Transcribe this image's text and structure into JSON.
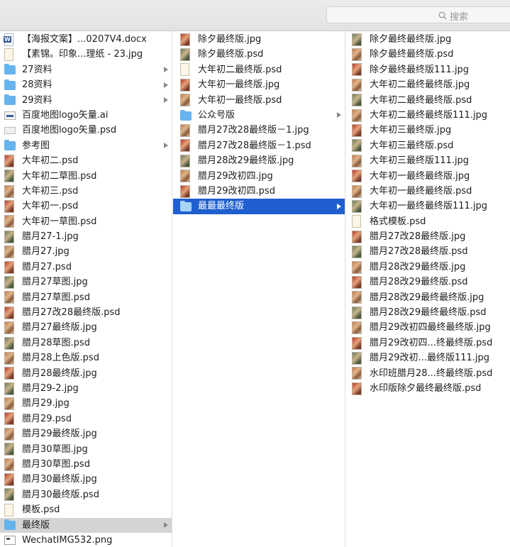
{
  "search": {
    "placeholder": "搜索"
  },
  "columns": [
    {
      "items": [
        {
          "label": "【海报文案】...0207V4.docx",
          "icon": "word-doc-icon"
        },
        {
          "label": "【素锦。印象...理纸 - 23.jpg",
          "icon": "blank-image-icon"
        },
        {
          "label": "27资料",
          "icon": "folder-icon",
          "arrow": true
        },
        {
          "label": "28资料",
          "icon": "folder-icon",
          "arrow": true
        },
        {
          "label": "29资料",
          "icon": "folder-icon",
          "arrow": true
        },
        {
          "label": "百度地图logo矢量.ai",
          "icon": "ai-file-icon"
        },
        {
          "label": "百度地图logo矢量.psd",
          "icon": "psd-file-icon"
        },
        {
          "label": "参考图",
          "icon": "folder-icon",
          "arrow": true
        },
        {
          "label": "大年初二.psd",
          "icon": "image-thumbnail-icon"
        },
        {
          "label": "大年初二草图.psd",
          "icon": "image-thumbnail-icon"
        },
        {
          "label": "大年初三.psd",
          "icon": "image-thumbnail-icon"
        },
        {
          "label": "大年初一.psd",
          "icon": "image-thumbnail-icon"
        },
        {
          "label": "大年初一草图.psd",
          "icon": "image-thumbnail-icon"
        },
        {
          "label": "腊月27-1.jpg",
          "icon": "image-thumbnail-icon"
        },
        {
          "label": "腊月27.jpg",
          "icon": "image-thumbnail-icon"
        },
        {
          "label": "腊月27.psd",
          "icon": "image-thumbnail-icon"
        },
        {
          "label": "腊月27草图.jpg",
          "icon": "image-thumbnail-icon"
        },
        {
          "label": "腊月27草图.psd",
          "icon": "image-thumbnail-icon"
        },
        {
          "label": "腊月27改28最终版.psd",
          "icon": "image-thumbnail-icon"
        },
        {
          "label": "腊月27最终版.jpg",
          "icon": "image-thumbnail-icon"
        },
        {
          "label": "腊月28草图.psd",
          "icon": "image-thumbnail-icon"
        },
        {
          "label": "腊月28上色版.psd",
          "icon": "image-thumbnail-icon"
        },
        {
          "label": "腊月28最终版.jpg",
          "icon": "image-thumbnail-icon"
        },
        {
          "label": "腊月29-2.jpg",
          "icon": "image-thumbnail-icon"
        },
        {
          "label": "腊月29.jpg",
          "icon": "image-thumbnail-icon"
        },
        {
          "label": "腊月29.psd",
          "icon": "image-thumbnail-icon"
        },
        {
          "label": "腊月29最终版.jpg",
          "icon": "image-thumbnail-icon"
        },
        {
          "label": "腊月30草图.jpg",
          "icon": "image-thumbnail-icon"
        },
        {
          "label": "腊月30草图.psd",
          "icon": "image-thumbnail-icon"
        },
        {
          "label": "腊月30最终版.jpg",
          "icon": "image-thumbnail-icon"
        },
        {
          "label": "腊月30最终版.psd",
          "icon": "image-thumbnail-icon"
        },
        {
          "label": "模板.psd",
          "icon": "blank-image-icon"
        },
        {
          "label": "最终版",
          "icon": "folder-icon",
          "arrow": true,
          "state": "inactive-selected"
        },
        {
          "label": "WechatIMG532.png",
          "icon": "png-file-icon"
        }
      ]
    },
    {
      "items": [
        {
          "label": "除夕最终版.jpg",
          "icon": "image-thumbnail-icon"
        },
        {
          "label": "除夕最终版.psd",
          "icon": "image-thumbnail-icon"
        },
        {
          "label": "大年初二最终版.psd",
          "icon": "blank-image-icon"
        },
        {
          "label": "大年初一最终版.jpg",
          "icon": "image-thumbnail-icon"
        },
        {
          "label": "大年初一最终版.psd",
          "icon": "image-thumbnail-icon"
        },
        {
          "label": "公众号版",
          "icon": "folder-icon",
          "arrow": true
        },
        {
          "label": "腊月27改28最终版－1.jpg",
          "icon": "image-thumbnail-icon"
        },
        {
          "label": "腊月27改28最终版－1.psd",
          "icon": "image-thumbnail-icon"
        },
        {
          "label": "腊月28改29最终版.jpg",
          "icon": "image-thumbnail-icon"
        },
        {
          "label": "腊月29改初四.jpg",
          "icon": "image-thumbnail-icon"
        },
        {
          "label": "腊月29改初四.psd",
          "icon": "image-thumbnail-icon"
        },
        {
          "label": "最最最终版",
          "icon": "folder-icon",
          "arrow": true,
          "state": "selected"
        }
      ]
    },
    {
      "items": [
        {
          "label": "除夕最终最终版.jpg",
          "icon": "image-thumbnail-icon"
        },
        {
          "label": "除夕最终最终版.psd",
          "icon": "image-thumbnail-icon"
        },
        {
          "label": "除夕最终最终版111.jpg",
          "icon": "image-thumbnail-icon"
        },
        {
          "label": "大年初二最终最终版.jpg",
          "icon": "image-thumbnail-icon"
        },
        {
          "label": "大年初二最终最终版.psd",
          "icon": "image-thumbnail-icon"
        },
        {
          "label": "大年初二最终最终版111.jpg",
          "icon": "image-thumbnail-icon"
        },
        {
          "label": "大年初三最终版.jpg",
          "icon": "image-thumbnail-icon"
        },
        {
          "label": "大年初三最终版.psd",
          "icon": "image-thumbnail-icon"
        },
        {
          "label": "大年初三最终版111.jpg",
          "icon": "image-thumbnail-icon"
        },
        {
          "label": "大年初一最终最终版.jpg",
          "icon": "image-thumbnail-icon"
        },
        {
          "label": "大年初一最终最终版.psd",
          "icon": "image-thumbnail-icon"
        },
        {
          "label": "大年初一最终最终版111.jpg",
          "icon": "image-thumbnail-icon"
        },
        {
          "label": "格式模板.psd",
          "icon": "blank-image-icon"
        },
        {
          "label": "腊月27改28最终版.jpg",
          "icon": "image-thumbnail-icon"
        },
        {
          "label": "腊月27改28最终版.psd",
          "icon": "image-thumbnail-icon"
        },
        {
          "label": "腊月28改29最终版.jpg",
          "icon": "image-thumbnail-icon"
        },
        {
          "label": "腊月28改29最终版.psd",
          "icon": "image-thumbnail-icon"
        },
        {
          "label": "腊月28改29最终最终版.jpg",
          "icon": "image-thumbnail-icon"
        },
        {
          "label": "腊月28改29最终最终版.psd",
          "icon": "image-thumbnail-icon"
        },
        {
          "label": "腊月29改初四最终最终版.jpg",
          "icon": "image-thumbnail-icon"
        },
        {
          "label": "腊月29改初四...终最终版.psd",
          "icon": "image-thumbnail-icon"
        },
        {
          "label": "腊月29改初...最终版111.jpg",
          "icon": "image-thumbnail-icon"
        },
        {
          "label": "水印班腊月28...终最终版.psd",
          "icon": "image-thumbnail-icon"
        },
        {
          "label": "水印版除夕最终最终版.psd",
          "icon": "image-thumbnail-icon"
        }
      ]
    }
  ],
  "colors": {
    "selection": "#1f5fd0",
    "inactive_selection": "#d4d4d4",
    "folder": "#66b3ee"
  }
}
